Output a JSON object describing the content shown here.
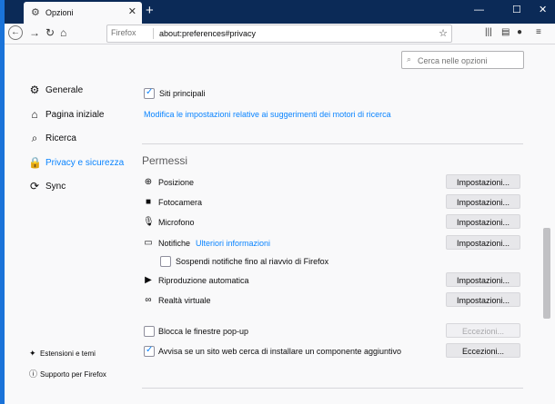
{
  "tab": {
    "title": "Opzioni"
  },
  "urlbar": {
    "identity": "Firefox",
    "url": "about:preferences#privacy"
  },
  "search": {
    "placeholder": "Cerca nelle opzioni"
  },
  "sidebar": {
    "items": [
      {
        "label": "Generale"
      },
      {
        "label": "Pagina iniziale"
      },
      {
        "label": "Ricerca"
      },
      {
        "label": "Privacy e sicurezza"
      },
      {
        "label": "Sync"
      }
    ],
    "footer": [
      {
        "label": "Estensioni e temi"
      },
      {
        "label": "Supporto per Firefox"
      }
    ]
  },
  "main": {
    "top_sites_label": "Siti principali",
    "suggestions_link": "Modifica le impostazioni relative ai suggerimenti dei motori di ricerca",
    "permissions_heading": "Permessi",
    "permissions": [
      {
        "label": "Posizione",
        "button": "Impostazioni..."
      },
      {
        "label": "Fotocamera",
        "button": "Impostazioni..."
      },
      {
        "label": "Microfono",
        "button": "Impostazioni..."
      },
      {
        "label": "Notifiche",
        "link": "Ulteriori informazioni",
        "button": "Impostazioni..."
      },
      {
        "label": "Riproduzione automatica",
        "button": "Impostazioni..."
      },
      {
        "label": "Realtà virtuale",
        "button": "Impostazioni..."
      }
    ],
    "pause_notifications_label": "Sospendi notifiche fino al riavvio di Firefox",
    "block_popups_label": "Blocca le finestre pop-up",
    "block_popups_button": "Eccezioni...",
    "addons_warn_label": "Avvisa se un sito web cerca di installare un componente aggiuntivo",
    "addons_warn_button": "Eccezioni..."
  },
  "colors": {
    "accent": "#0a84ff",
    "titlebar": "#0b2a57"
  }
}
